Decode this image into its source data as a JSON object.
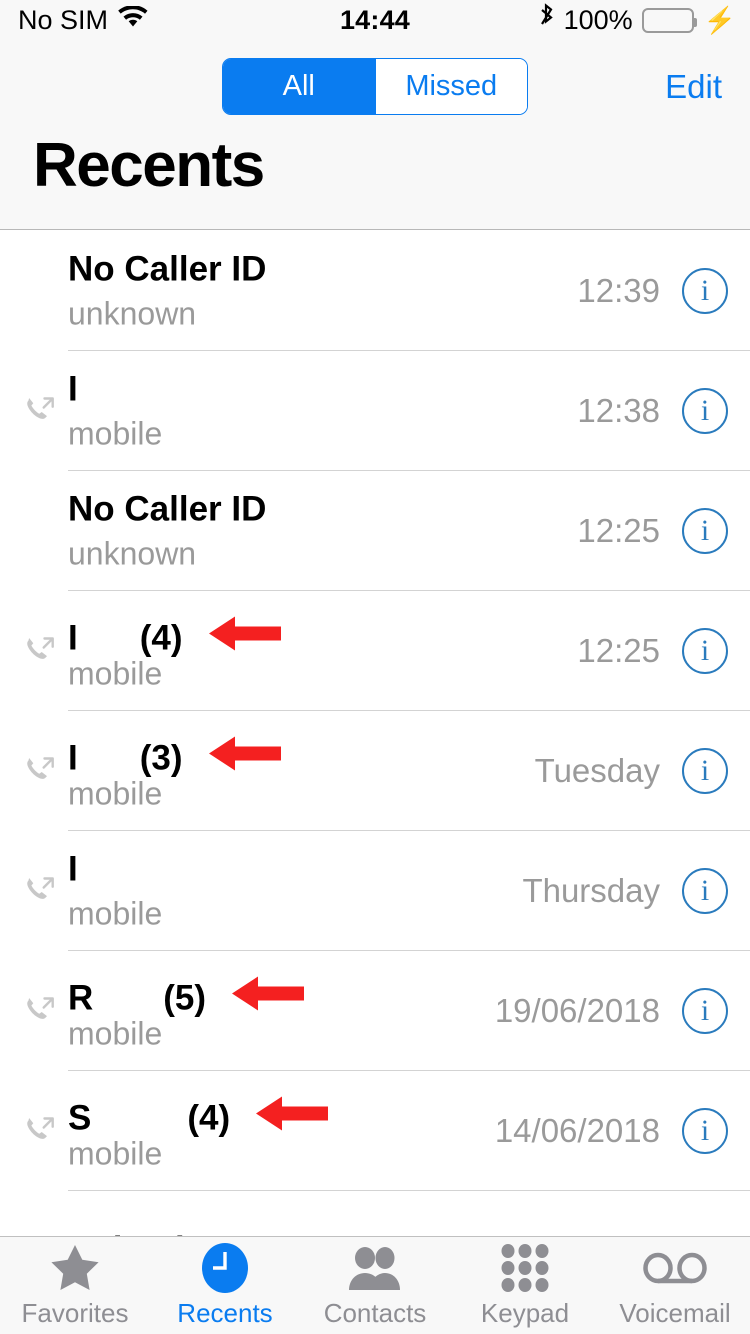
{
  "status_bar": {
    "carrier": "No SIM",
    "wifi_icon": "wifi-icon",
    "time": "14:44",
    "bluetooth_icon": "bluetooth-icon",
    "battery_percent": "100%",
    "battery_icon": "battery-full-icon",
    "charging_icon": "lightning-bolt-icon",
    "battery_color": "#4cd964"
  },
  "nav": {
    "segments": [
      {
        "label": "All",
        "active": true
      },
      {
        "label": "Missed",
        "active": false
      }
    ],
    "edit_label": "Edit",
    "title": "Recents",
    "accent_color": "#0a7cf0"
  },
  "calls": [
    {
      "name": "No Caller ID",
      "count": "",
      "subtitle": "unknown",
      "time": "12:39",
      "call_type": "none",
      "arrow": false
    },
    {
      "name": "I",
      "count": "",
      "subtitle": "mobile",
      "time": "12:38",
      "call_type": "outgoing",
      "arrow": false
    },
    {
      "name": "No Caller ID",
      "count": "",
      "subtitle": "unknown",
      "time": "12:25",
      "call_type": "none",
      "arrow": false
    },
    {
      "name": "I",
      "count": "(4)",
      "subtitle": "mobile",
      "time": "12:25",
      "call_type": "outgoing",
      "arrow": true
    },
    {
      "name": "I",
      "count": "(3)",
      "subtitle": "mobile",
      "time": "Tuesday",
      "call_type": "outgoing",
      "arrow": true
    },
    {
      "name": "I",
      "count": "",
      "subtitle": "mobile",
      "time": "Thursday",
      "call_type": "outgoing",
      "arrow": false
    },
    {
      "name": "R",
      "count": "(5)",
      "subtitle": "mobile",
      "time": "19/06/2018",
      "call_type": "outgoing",
      "arrow": true
    },
    {
      "name": "S",
      "count": "(4)",
      "subtitle": "mobile",
      "time": "14/06/2018",
      "call_type": "outgoing",
      "arrow": true
    },
    {
      "name": "Poland",
      "count": "",
      "subtitle": "",
      "time": "",
      "call_type": "outgoing",
      "arrow": false
    }
  ],
  "annotation": {
    "arrow_color": "#f42020",
    "arrow_icon": "left-pointing-arrow-icon"
  },
  "info_button": {
    "icon": "info-icon",
    "label": "i",
    "color": "#2a7bbd"
  },
  "tabs": [
    {
      "label": "Favorites",
      "icon": "star-icon",
      "active": false
    },
    {
      "label": "Recents",
      "icon": "clock-icon",
      "active": true
    },
    {
      "label": "Contacts",
      "icon": "people-icon",
      "active": false
    },
    {
      "label": "Keypad",
      "icon": "keypad-dots-icon",
      "active": false
    },
    {
      "label": "Voicemail",
      "icon": "voicemail-icon",
      "active": false
    }
  ]
}
